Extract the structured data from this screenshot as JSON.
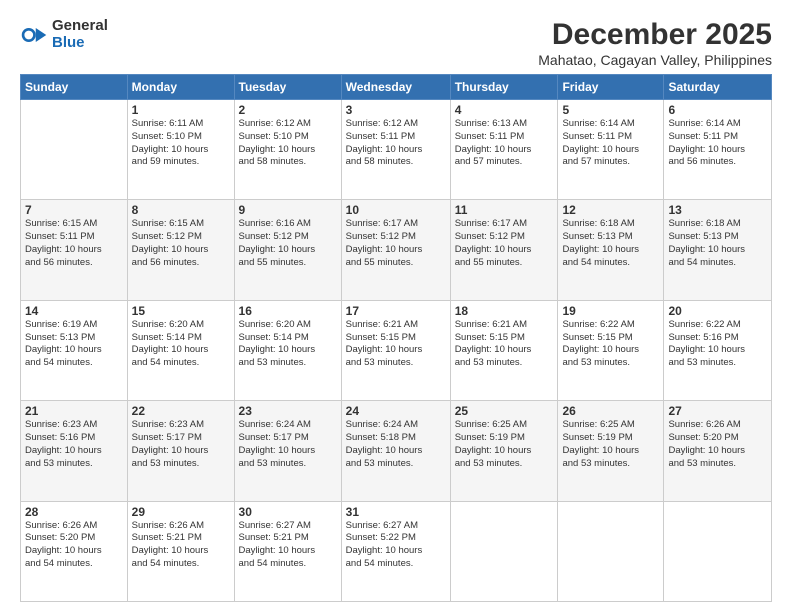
{
  "logo": {
    "general": "General",
    "blue": "Blue"
  },
  "title": "December 2025",
  "subtitle": "Mahatao, Cagayan Valley, Philippines",
  "headers": [
    "Sunday",
    "Monday",
    "Tuesday",
    "Wednesday",
    "Thursday",
    "Friday",
    "Saturday"
  ],
  "weeks": [
    [
      {
        "day": "",
        "info": ""
      },
      {
        "day": "1",
        "info": "Sunrise: 6:11 AM\nSunset: 5:10 PM\nDaylight: 10 hours\nand 59 minutes."
      },
      {
        "day": "2",
        "info": "Sunrise: 6:12 AM\nSunset: 5:10 PM\nDaylight: 10 hours\nand 58 minutes."
      },
      {
        "day": "3",
        "info": "Sunrise: 6:12 AM\nSunset: 5:11 PM\nDaylight: 10 hours\nand 58 minutes."
      },
      {
        "day": "4",
        "info": "Sunrise: 6:13 AM\nSunset: 5:11 PM\nDaylight: 10 hours\nand 57 minutes."
      },
      {
        "day": "5",
        "info": "Sunrise: 6:14 AM\nSunset: 5:11 PM\nDaylight: 10 hours\nand 57 minutes."
      },
      {
        "day": "6",
        "info": "Sunrise: 6:14 AM\nSunset: 5:11 PM\nDaylight: 10 hours\nand 56 minutes."
      }
    ],
    [
      {
        "day": "7",
        "info": "Sunrise: 6:15 AM\nSunset: 5:11 PM\nDaylight: 10 hours\nand 56 minutes."
      },
      {
        "day": "8",
        "info": "Sunrise: 6:15 AM\nSunset: 5:12 PM\nDaylight: 10 hours\nand 56 minutes."
      },
      {
        "day": "9",
        "info": "Sunrise: 6:16 AM\nSunset: 5:12 PM\nDaylight: 10 hours\nand 55 minutes."
      },
      {
        "day": "10",
        "info": "Sunrise: 6:17 AM\nSunset: 5:12 PM\nDaylight: 10 hours\nand 55 minutes."
      },
      {
        "day": "11",
        "info": "Sunrise: 6:17 AM\nSunset: 5:12 PM\nDaylight: 10 hours\nand 55 minutes."
      },
      {
        "day": "12",
        "info": "Sunrise: 6:18 AM\nSunset: 5:13 PM\nDaylight: 10 hours\nand 54 minutes."
      },
      {
        "day": "13",
        "info": "Sunrise: 6:18 AM\nSunset: 5:13 PM\nDaylight: 10 hours\nand 54 minutes."
      }
    ],
    [
      {
        "day": "14",
        "info": "Sunrise: 6:19 AM\nSunset: 5:13 PM\nDaylight: 10 hours\nand 54 minutes."
      },
      {
        "day": "15",
        "info": "Sunrise: 6:20 AM\nSunset: 5:14 PM\nDaylight: 10 hours\nand 54 minutes."
      },
      {
        "day": "16",
        "info": "Sunrise: 6:20 AM\nSunset: 5:14 PM\nDaylight: 10 hours\nand 53 minutes."
      },
      {
        "day": "17",
        "info": "Sunrise: 6:21 AM\nSunset: 5:15 PM\nDaylight: 10 hours\nand 53 minutes."
      },
      {
        "day": "18",
        "info": "Sunrise: 6:21 AM\nSunset: 5:15 PM\nDaylight: 10 hours\nand 53 minutes."
      },
      {
        "day": "19",
        "info": "Sunrise: 6:22 AM\nSunset: 5:15 PM\nDaylight: 10 hours\nand 53 minutes."
      },
      {
        "day": "20",
        "info": "Sunrise: 6:22 AM\nSunset: 5:16 PM\nDaylight: 10 hours\nand 53 minutes."
      }
    ],
    [
      {
        "day": "21",
        "info": "Sunrise: 6:23 AM\nSunset: 5:16 PM\nDaylight: 10 hours\nand 53 minutes."
      },
      {
        "day": "22",
        "info": "Sunrise: 6:23 AM\nSunset: 5:17 PM\nDaylight: 10 hours\nand 53 minutes."
      },
      {
        "day": "23",
        "info": "Sunrise: 6:24 AM\nSunset: 5:17 PM\nDaylight: 10 hours\nand 53 minutes."
      },
      {
        "day": "24",
        "info": "Sunrise: 6:24 AM\nSunset: 5:18 PM\nDaylight: 10 hours\nand 53 minutes."
      },
      {
        "day": "25",
        "info": "Sunrise: 6:25 AM\nSunset: 5:19 PM\nDaylight: 10 hours\nand 53 minutes."
      },
      {
        "day": "26",
        "info": "Sunrise: 6:25 AM\nSunset: 5:19 PM\nDaylight: 10 hours\nand 53 minutes."
      },
      {
        "day": "27",
        "info": "Sunrise: 6:26 AM\nSunset: 5:20 PM\nDaylight: 10 hours\nand 53 minutes."
      }
    ],
    [
      {
        "day": "28",
        "info": "Sunrise: 6:26 AM\nSunset: 5:20 PM\nDaylight: 10 hours\nand 54 minutes."
      },
      {
        "day": "29",
        "info": "Sunrise: 6:26 AM\nSunset: 5:21 PM\nDaylight: 10 hours\nand 54 minutes."
      },
      {
        "day": "30",
        "info": "Sunrise: 6:27 AM\nSunset: 5:21 PM\nDaylight: 10 hours\nand 54 minutes."
      },
      {
        "day": "31",
        "info": "Sunrise: 6:27 AM\nSunset: 5:22 PM\nDaylight: 10 hours\nand 54 minutes."
      },
      {
        "day": "",
        "info": ""
      },
      {
        "day": "",
        "info": ""
      },
      {
        "day": "",
        "info": ""
      }
    ]
  ]
}
